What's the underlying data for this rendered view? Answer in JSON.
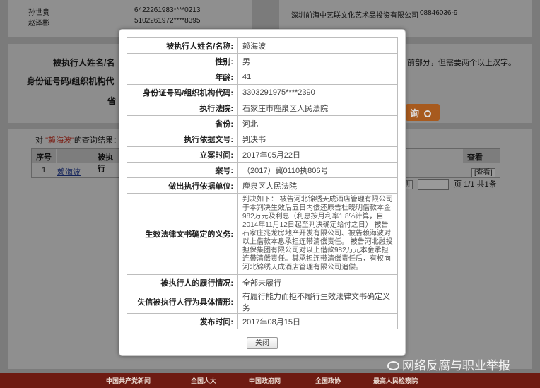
{
  "background": {
    "top_rows_left": [
      {
        "name": "孙世贵",
        "id": "6422261983****0213"
      },
      {
        "name": "赵泽彬",
        "id": "5102261972****8395"
      }
    ],
    "top_rows_right": [
      {
        "name": "深圳前海中艺联文化艺术品投资有限公司",
        "id": "08846036-9"
      }
    ],
    "form_labels": [
      "被执行人姓名/名",
      "身份证号码/组织机构代",
      "省"
    ],
    "form_hint": "前部分，但需要两个以上汉字。",
    "search_button": "询",
    "results_prefix": "对",
    "results_keyword": "\"赖海波\"",
    "results_suffix": "的查询结果：",
    "table_headers": {
      "seq": "序号",
      "name": "被执行",
      "view": "查看"
    },
    "table_row": {
      "seq": "1",
      "name": "赖海波",
      "view": "[查看]"
    },
    "pager": {
      "jump_btn": "到",
      "page_info": "页 1/1 共1条"
    },
    "footer_links": [
      "中国共产党新闻",
      "全国人大",
      "中国政府网",
      "全国政协",
      "最高人民检察院"
    ],
    "watermark": "网络反腐与职业举报"
  },
  "modal": {
    "rows": [
      {
        "label": "被执行人姓名/名称:",
        "value": "赖海波"
      },
      {
        "label": "性别:",
        "value": "男"
      },
      {
        "label": "年龄:",
        "value": "41"
      },
      {
        "label": "身份证号码/组织机构代码:",
        "value": "3303291975****2390"
      },
      {
        "label": "执行法院:",
        "value": "石家庄市鹿泉区人民法院"
      },
      {
        "label": "省份:",
        "value": "河北"
      },
      {
        "label": "执行依据文号:",
        "value": "判决书"
      },
      {
        "label": "立案时间:",
        "value": "2017年05月22日"
      },
      {
        "label": "案号:",
        "value": "（2017）冀0110执806号"
      },
      {
        "label": "做出执行依据单位:",
        "value": "鹿泉区人民法院"
      },
      {
        "label": "生效法律文书确定的义务:",
        "value": "判决如下：  被告河北锦绣天成酒店管理有限公司于本判决生效后五日内偿还原告杜晓明借款本金982万元及利息（利息按月利率1.8%计算，自2014年11月12日起至判决确定给付之日）  被告石家庄兆龙房地产开发有限公司、被告赖海波对以上借款本息承担连带清偿责任。  被告河北融投担保集团有限公司对以上借款982万元本金承担连带清偿责任。其承担连带清偿责任后，有权向河北锦绣天成酒店管理有限公司追偿。"
      },
      {
        "label": "被执行人的履行情况:",
        "value": "全部未履行"
      },
      {
        "label": "失信被执行人行为具体情形:",
        "value": "有履行能力而拒不履行生效法律文书确定义务"
      },
      {
        "label": "发布时间:",
        "value": "2017年08月15日"
      }
    ],
    "close_label": "关闭"
  }
}
